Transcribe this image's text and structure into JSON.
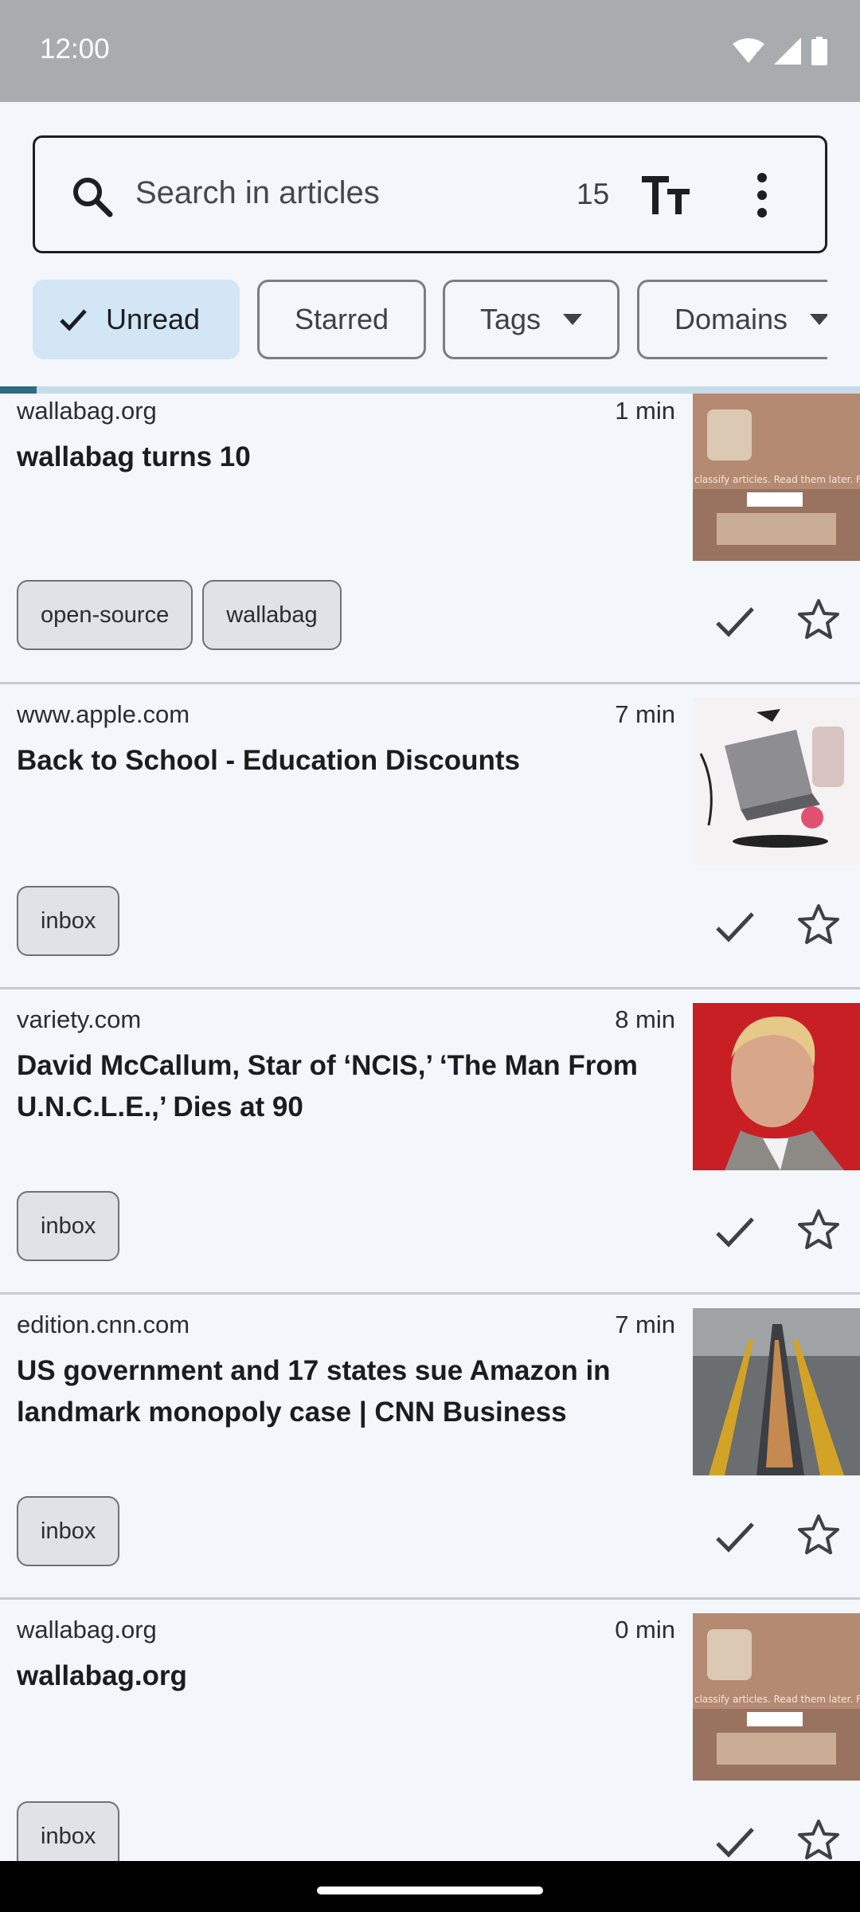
{
  "status_bar": {
    "time": "12:00",
    "icons": [
      "wifi-icon",
      "signal-icon",
      "battery-icon"
    ]
  },
  "search": {
    "placeholder": "Search in articles",
    "count": "15"
  },
  "filters": [
    {
      "label": "Unread",
      "selected": true
    },
    {
      "label": "Starred",
      "selected": false
    },
    {
      "label": "Tags",
      "dropdown": true
    },
    {
      "label": "Domains",
      "dropdown": true
    }
  ],
  "articles": [
    {
      "domain": "wallabag.org",
      "read_time": "1 min",
      "title": "wallabag turns 10",
      "tags": [
        "open-source",
        "wallabag"
      ],
      "thumbnail": "wallabag-thumbnail"
    },
    {
      "domain": "www.apple.com",
      "read_time": "7 min",
      "title": "Back to School - Education Discounts",
      "tags": [
        "inbox"
      ],
      "thumbnail": "apple-laptop-thumbnail"
    },
    {
      "domain": "variety.com",
      "read_time": "8 min",
      "title": "David McCallum, Star of ‘NCIS,’ ‘The Man From U.N.C.L.E.,’ Dies at 90",
      "tags": [
        "inbox"
      ],
      "thumbnail": "portrait-thumbnail"
    },
    {
      "domain": "edition.cnn.com",
      "read_time": "7 min",
      "title": "US government and 17 states sue Amazon in landmark monopoly case | CNN Business",
      "tags": [
        "inbox"
      ],
      "thumbnail": "warehouse-thumbnail"
    },
    {
      "domain": "wallabag.org",
      "read_time": "0 min",
      "title": "wallabag.org",
      "tags": [
        "inbox"
      ],
      "thumbnail": "wallabag-thumbnail"
    }
  ],
  "colors": {
    "accent": "#2d6a84",
    "chip_selected": "#d3e6f6",
    "background": "#f3f7fb"
  }
}
